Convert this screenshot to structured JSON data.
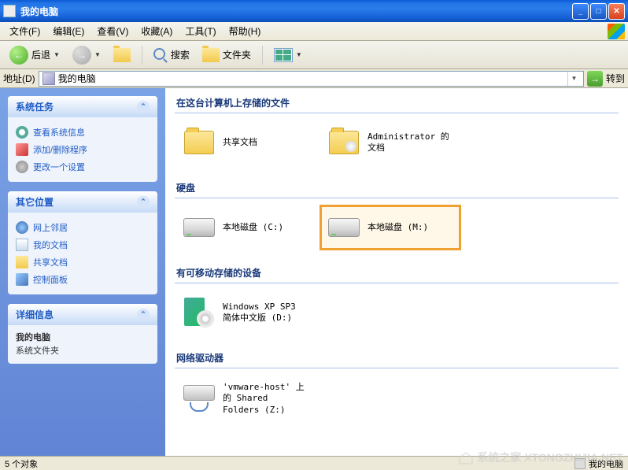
{
  "window": {
    "title": "我的电脑"
  },
  "menu": {
    "file": "文件(F)",
    "edit": "编辑(E)",
    "view": "查看(V)",
    "favorites": "收藏(A)",
    "tools": "工具(T)",
    "help": "帮助(H)"
  },
  "toolbar": {
    "back": "后退",
    "search": "搜索",
    "folders": "文件夹"
  },
  "addressbar": {
    "label": "地址(D)",
    "value": "我的电脑",
    "go": "转到"
  },
  "sidebar": {
    "system_tasks": {
      "title": "系统任务",
      "items": [
        "查看系统信息",
        "添加/删除程序",
        "更改一个设置"
      ]
    },
    "other_places": {
      "title": "其它位置",
      "items": [
        "网上邻居",
        "我的文档",
        "共享文档",
        "控制面板"
      ]
    },
    "details": {
      "title": "详细信息",
      "name": "我的电脑",
      "type": "系统文件夹"
    }
  },
  "content": {
    "sections": {
      "files_stored": {
        "header": "在这台计算机上存储的文件",
        "items": [
          {
            "label": "共享文档"
          },
          {
            "label": "Administrator 的文档"
          }
        ]
      },
      "hard_disks": {
        "header": "硬盘",
        "items": [
          {
            "label": "本地磁盘 (C:)"
          },
          {
            "label": "本地磁盘 (M:)",
            "selected": true
          }
        ]
      },
      "removable": {
        "header": "有可移动存储的设备",
        "items": [
          {
            "label": "Windows XP SP3 简体中文版 (D:)"
          }
        ]
      },
      "network_drives": {
        "header": "网络驱动器",
        "items": [
          {
            "label": "'vmware-host' 上的 Shared Folders (Z:)"
          }
        ]
      }
    }
  },
  "statusbar": {
    "left": "5 个对象",
    "right": "我的电脑"
  },
  "watermark": "系统之家 XTONGZHIJIA.NET"
}
